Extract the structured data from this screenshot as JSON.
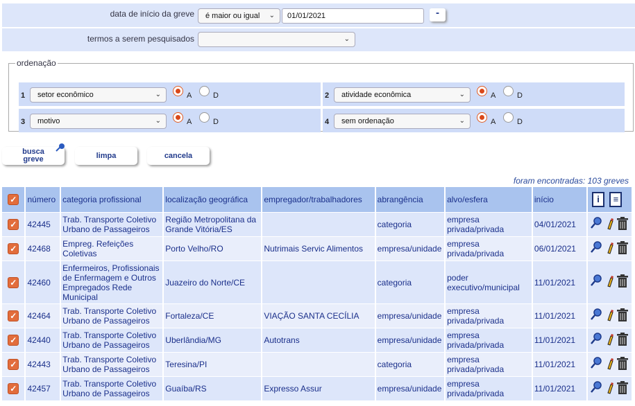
{
  "filters": {
    "start_date_label": "data de início da greve",
    "start_date_operator": "é maior ou igual",
    "start_date_value": "01/01/2021",
    "remove_button": "-",
    "terms_label": "termos a serem pesquisados",
    "terms_value": ""
  },
  "ordering": {
    "legend": "ordenação",
    "items": [
      {
        "num": "1",
        "field": "setor econômico",
        "asc": "A",
        "desc": "D"
      },
      {
        "num": "2",
        "field": "atividade econômica",
        "asc": "A",
        "desc": "D"
      },
      {
        "num": "3",
        "field": "motivo",
        "asc": "A",
        "desc": "D"
      },
      {
        "num": "4",
        "field": "sem ordenação",
        "asc": "A",
        "desc": "D"
      }
    ]
  },
  "actions": {
    "search_line1": "busca",
    "search_line2": "greve",
    "clear": "limpa",
    "cancel": "cancela"
  },
  "results": {
    "count_text": "foram encontradas: 103 greves",
    "columns": [
      "número",
      "categoria profissional",
      "localização geográfica",
      "empregador/trabalhadores",
      "abrangência",
      "alvo/esfera",
      "início"
    ],
    "rows": [
      {
        "numero": "42445",
        "categoria": "Trab. Transporte Coletivo Urbano de Passageiros",
        "local": "Região Metropolitana da Grande Vitória/ES",
        "empregador": "",
        "abrangencia": "categoria",
        "alvo": "empresa privada/privada",
        "inicio": "04/01/2021"
      },
      {
        "numero": "42468",
        "categoria": "Empreg. Refeições Coletivas",
        "local": "Porto Velho/RO",
        "empregador": "Nutrimais Servic Alimentos",
        "abrangencia": "empresa/unidade",
        "alvo": "empresa privada/privada",
        "inicio": "06/01/2021"
      },
      {
        "numero": "42460",
        "categoria": "Enfermeiros, Profissionais de Enfermagem e Outros Empregados Rede Municipal",
        "local": "Juazeiro do Norte/CE",
        "empregador": "",
        "abrangencia": "categoria",
        "alvo": "poder executivo/municipal",
        "inicio": "11/01/2021"
      },
      {
        "numero": "42464",
        "categoria": "Trab. Transporte Coletivo Urbano de Passageiros",
        "local": "Fortaleza/CE",
        "empregador": "VIAÇÃO SANTA CECÍLIA",
        "abrangencia": "empresa/unidade",
        "alvo": "empresa privada/privada",
        "inicio": "11/01/2021"
      },
      {
        "numero": "42440",
        "categoria": "Trab. Transporte Coletivo Urbano de Passageiros",
        "local": "Uberlândia/MG",
        "empregador": "Autotrans",
        "abrangencia": "empresa/unidade",
        "alvo": "empresa privada/privada",
        "inicio": "11/01/2021"
      },
      {
        "numero": "42443",
        "categoria": "Trab. Transporte Coletivo Urbano de Passageiros",
        "local": "Teresina/PI",
        "empregador": "",
        "abrangencia": "categoria",
        "alvo": "empresa privada/privada",
        "inicio": "11/01/2021"
      },
      {
        "numero": "42457",
        "categoria": "Trab. Transporte Coletivo Urbano de Passageiros",
        "local": "Guaíba/RS",
        "empregador": "Expresso Assur",
        "abrangencia": "empresa/unidade",
        "alvo": "empresa privada/privada",
        "inicio": "11/01/2021"
      }
    ]
  }
}
